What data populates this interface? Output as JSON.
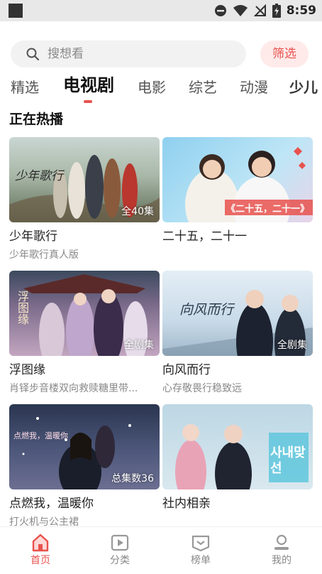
{
  "status_bar": {
    "time": "8:59"
  },
  "search": {
    "placeholder": "搜想看",
    "filter_label": "筛选"
  },
  "tabs": [
    {
      "label": "精选"
    },
    {
      "label": "电视剧"
    },
    {
      "label": "电影"
    },
    {
      "label": "综艺"
    },
    {
      "label": "动漫"
    },
    {
      "label": "少儿"
    }
  ],
  "section": {
    "title": "正在热播"
  },
  "cards": [
    {
      "title": "少年歌行",
      "subtitle": "少年歌行真人版",
      "badge": "全40集",
      "poster_text": "少年歌行"
    },
    {
      "title": "二十五，二十一",
      "subtitle": "",
      "badge": "",
      "poster_text": "《二十五，二十一》"
    },
    {
      "title": "浮图缘",
      "subtitle": "肖铎步音楼双向救赎糖里带...",
      "badge": "全剧集",
      "poster_text": "浮图缘"
    },
    {
      "title": "向风而行",
      "subtitle": "心存敬畏行稳致远",
      "badge": "全剧集",
      "poster_text": "向风而行"
    },
    {
      "title": "点燃我，温暖你",
      "subtitle": "打火机与公主裙",
      "badge": "总集数36",
      "poster_text": "点燃我，温暖你"
    },
    {
      "title": "社内相亲",
      "subtitle": "",
      "badge": "",
      "poster_text": "사내맞선"
    }
  ],
  "bottom_nav": [
    {
      "label": "首页",
      "icon": "home-icon"
    },
    {
      "label": "分类",
      "icon": "category-icon"
    },
    {
      "label": "榜单",
      "icon": "ranking-icon"
    },
    {
      "label": "我的",
      "icon": "profile-icon"
    }
  ],
  "colors": {
    "accent": "#e8524d",
    "filter_bg": "#ffeaea",
    "search_bg": "#f2f2f2"
  }
}
